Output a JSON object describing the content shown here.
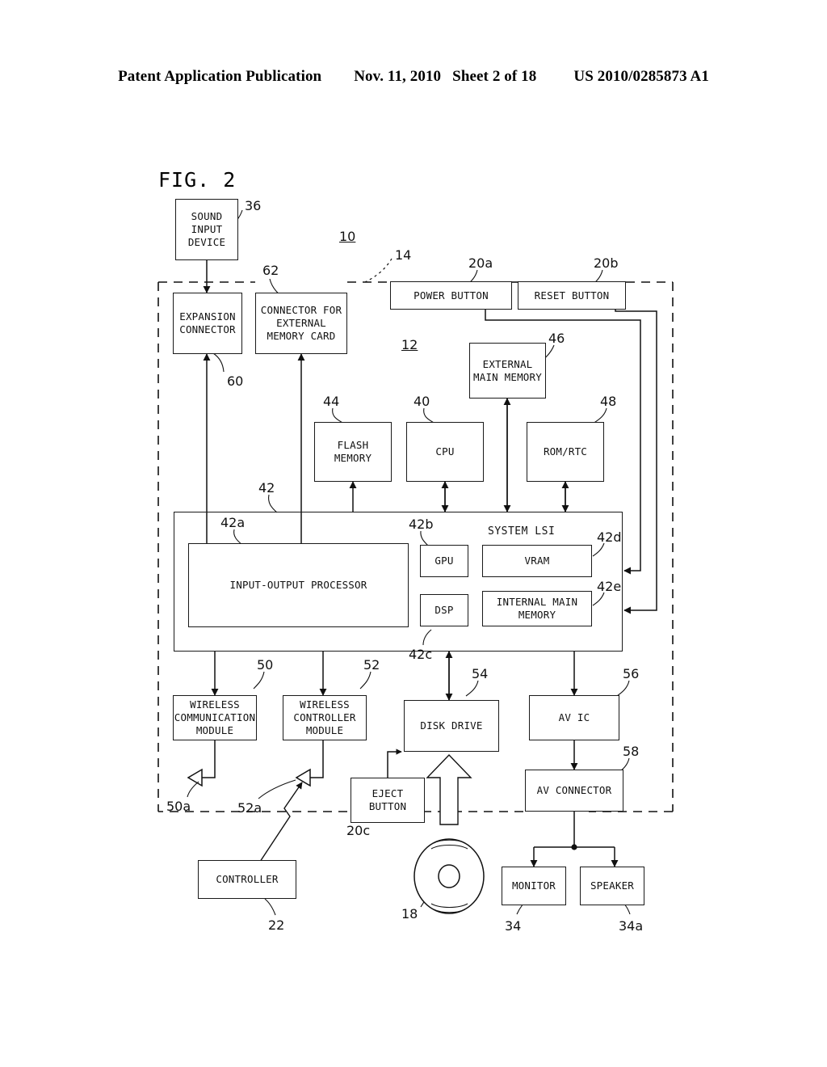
{
  "header": {
    "left": "Patent Application Publication",
    "date": "Nov. 11, 2010",
    "sheet": "Sheet 2 of 18",
    "patent_number": "US 2010/0285873 A1"
  },
  "figure": {
    "label": "FIG. 2",
    "system_lsi_title": "SYSTEM LSI"
  },
  "blocks": {
    "sound_input_device": "SOUND\nINPUT\nDEVICE",
    "expansion_connector": "EXPANSION\nCONNECTOR",
    "connector_external_memory_card": "CONNECTOR FOR\nEXTERNAL\nMEMORY CARD",
    "power_button": "POWER BUTTON",
    "reset_button": "RESET BUTTON",
    "external_main_memory": "EXTERNAL\nMAIN MEMORY",
    "flash_memory": "FLASH\nMEMORY",
    "cpu": "CPU",
    "rom_rtc": "ROM/RTC",
    "input_output_processor": "INPUT-OUTPUT PROCESSOR",
    "gpu": "GPU",
    "dsp": "DSP",
    "vram": "VRAM",
    "internal_main_memory": "INTERNAL MAIN\nMEMORY",
    "wireless_communication_module": "WIRELESS\nCOMMUNICATION\nMODULE",
    "wireless_controller_module": "WIRELESS\nCONTROLLER\nMODULE",
    "disk_drive": "DISK DRIVE",
    "av_ic": "AV IC",
    "av_connector": "AV CONNECTOR",
    "eject_button": "EJECT\nBUTTON",
    "controller": "CONTROLLER",
    "monitor": "MONITOR",
    "speaker": "SPEAKER"
  },
  "refs": {
    "r10": "10",
    "r12": "12",
    "r14": "14",
    "r18": "18",
    "r20a": "20a",
    "r20b": "20b",
    "r20c": "20c",
    "r22": "22",
    "r34": "34",
    "r34a": "34a",
    "r36": "36",
    "r40": "40",
    "r42": "42",
    "r42a": "42a",
    "r42b": "42b",
    "r42c": "42c",
    "r42d": "42d",
    "r42e": "42e",
    "r44": "44",
    "r46": "46",
    "r48": "48",
    "r50": "50",
    "r50a": "50a",
    "r52": "52",
    "r52a": "52a",
    "r54": "54",
    "r56": "56",
    "r58": "58",
    "r60": "60",
    "r62": "62"
  }
}
